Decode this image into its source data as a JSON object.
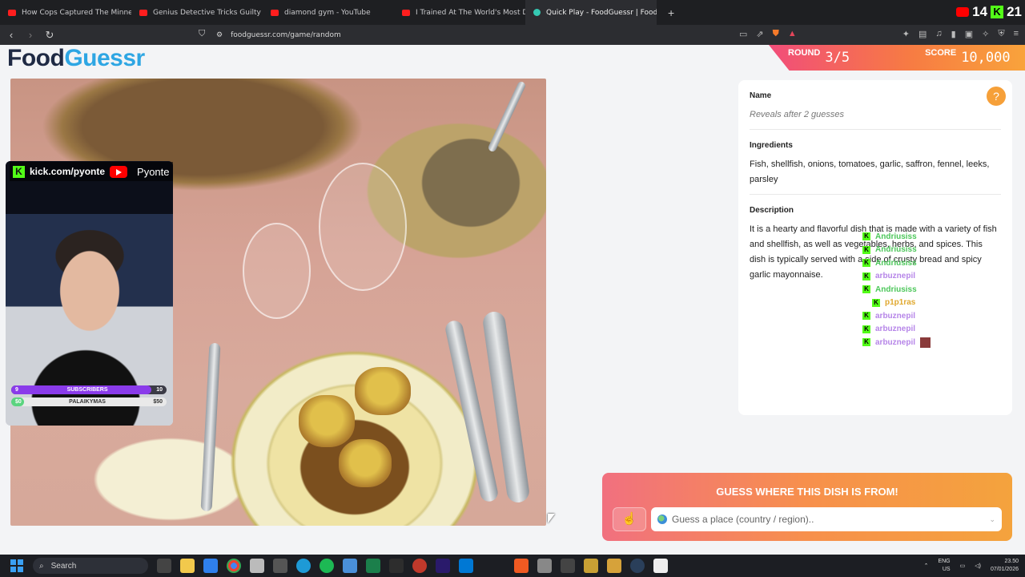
{
  "browser": {
    "tabs": [
      {
        "title": "How Cops Captured The Minnesota I",
        "active": false
      },
      {
        "title": "Genius Detective Tricks Guilty Suspe",
        "active": false
      },
      {
        "title": "diamond gym - YouTube",
        "active": false
      },
      {
        "title": "I Trained At The World's Most Dange",
        "active": false
      },
      {
        "title": "Quick Play - FoodGuessr | FoodG",
        "active": true
      }
    ],
    "close_tab_glyph": "✕",
    "new_tab_glyph": "+",
    "url": "foodguessr.com/game/random",
    "stream_stats": {
      "left": "14",
      "right": "21"
    }
  },
  "app": {
    "logo_part1": "Food",
    "logo_part2": "Guessr",
    "round_label": "ROUND",
    "round_value": "3/5",
    "score_label": "SCORE",
    "score_value": "10,000"
  },
  "overlay": {
    "kick_handle": "kick.com/pyonte",
    "yt_name": "Pyonte",
    "subs_goal": {
      "label": "SUBSCRIBERS",
      "current": "9",
      "target": "10",
      "progress": 0.9
    },
    "donation_goal": {
      "label": "PALAIKYMAS",
      "current": "$0",
      "target": "$50",
      "progress": 0.0
    }
  },
  "info": {
    "help_glyph": "?",
    "name_label": "Name",
    "name_value": "Reveals after 2 guesses",
    "ingredients_label": "Ingredients",
    "ingredients_value": "Fish, shellfish, onions, tomatoes, garlic, saffron, fennel, leeks, parsley",
    "description_label": "Description",
    "description_value": "It is a hearty and flavorful dish that is made with a variety of fish and shellfish, as well as vegetables, herbs, and spices. This dish is typically served with a side of crusty bread and spicy garlic mayonnaise."
  },
  "chat": [
    {
      "user": "Andriusiss",
      "color": "#4cc75a"
    },
    {
      "user": "Andriusiss",
      "color": "#4cc75a"
    },
    {
      "user": "Andriusiss",
      "color": "#4cc75a"
    },
    {
      "user": "arbuznepil",
      "color": "#b685e8"
    },
    {
      "user": "Andriusiss",
      "color": "#4cc75a"
    },
    {
      "user": "p1p1ras",
      "color": "#e0a82e"
    },
    {
      "user": "arbuznepil",
      "color": "#b685e8"
    },
    {
      "user": "arbuznepil",
      "color": "#b685e8"
    },
    {
      "user": "arbuznepil",
      "color": "#b685e8"
    }
  ],
  "guess": {
    "title": "GUESS WHERE THIS DISH IS FROM!",
    "placeholder": "Guess a place (country / region).."
  },
  "taskbar": {
    "search_placeholder": "Search",
    "lang": "ENG",
    "region": "US",
    "time": "23.50",
    "date": "07/01/2026"
  }
}
